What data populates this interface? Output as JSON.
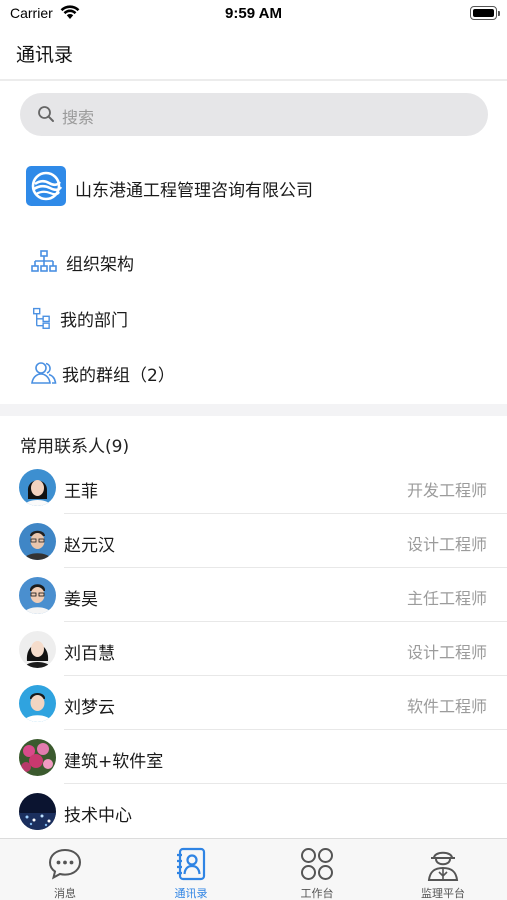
{
  "status_bar": {
    "carrier": "Carrier",
    "time": "9:59 AM"
  },
  "header": {
    "title": "通讯录"
  },
  "search": {
    "placeholder": "搜索"
  },
  "company": {
    "name": "山东港通工程管理咨询有限公司"
  },
  "menu": [
    {
      "label": "组织架构",
      "icon": "org-chart-icon"
    },
    {
      "label": "我的部门",
      "icon": "department-icon"
    },
    {
      "label": "我的群组（2）",
      "icon": "group-icon"
    }
  ],
  "frequent": {
    "title": "常用联系人(9)",
    "contacts": [
      {
        "name": "王菲",
        "role": "开发工程师"
      },
      {
        "name": "赵元汉",
        "role": "设计工程师"
      },
      {
        "name": "姜昊",
        "role": "主任工程师"
      },
      {
        "name": "刘百慧",
        "role": "设计工程师"
      },
      {
        "name": "刘梦云",
        "role": "软件工程师"
      },
      {
        "name": "建筑+软件室",
        "role": ""
      },
      {
        "name": "技术中心",
        "role": ""
      }
    ]
  },
  "tabs": [
    {
      "label": "消息",
      "icon": "message-icon",
      "active": false
    },
    {
      "label": "通讯录",
      "icon": "contacts-icon",
      "active": true
    },
    {
      "label": "工作台",
      "icon": "workbench-icon",
      "active": false
    },
    {
      "label": "监理平台",
      "icon": "supervisor-icon",
      "active": false
    }
  ],
  "colors": {
    "accent": "#2f84e4",
    "icon_blue": "#4a90e2",
    "inactive": "#555555"
  }
}
